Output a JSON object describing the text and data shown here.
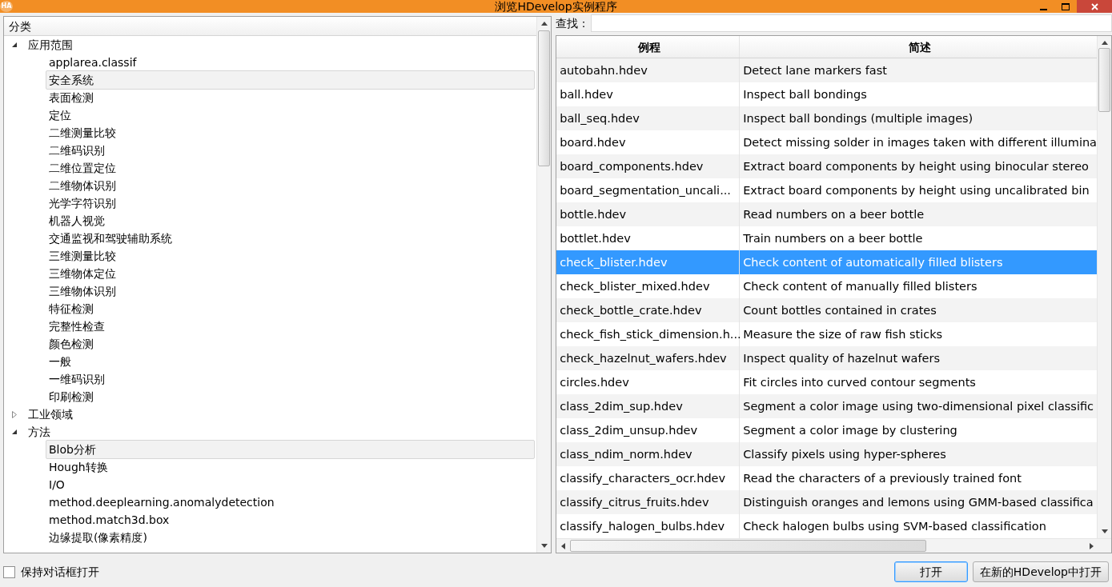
{
  "window": {
    "icon_label": "HA",
    "title": "浏览HDevelop实例程序"
  },
  "tree": {
    "header": "分类",
    "items": [
      {
        "label": "应用范围",
        "expanded": true,
        "selected": false,
        "children": [
          {
            "label": "applarea.classif",
            "selected": false
          },
          {
            "label": "安全系统",
            "selected": true
          },
          {
            "label": "表面检测",
            "selected": false
          },
          {
            "label": "定位",
            "selected": false
          },
          {
            "label": "二维测量比较",
            "selected": false
          },
          {
            "label": "二维码识别",
            "selected": false
          },
          {
            "label": "二维位置定位",
            "selected": false
          },
          {
            "label": "二维物体识别",
            "selected": false
          },
          {
            "label": "光学字符识别",
            "selected": false
          },
          {
            "label": "机器人视觉",
            "selected": false
          },
          {
            "label": "交通监视和驾驶辅助系统",
            "selected": false
          },
          {
            "label": "三维测量比较",
            "selected": false
          },
          {
            "label": "三维物体定位",
            "selected": false
          },
          {
            "label": "三维物体识别",
            "selected": false
          },
          {
            "label": "特征检测",
            "selected": false
          },
          {
            "label": "完整性检查",
            "selected": false
          },
          {
            "label": "颜色检测",
            "selected": false
          },
          {
            "label": "一般",
            "selected": false
          },
          {
            "label": "一维码识别",
            "selected": false
          },
          {
            "label": "印刷检测",
            "selected": false
          }
        ]
      },
      {
        "label": "工业领域",
        "expanded": false,
        "selected": false
      },
      {
        "label": "方法",
        "expanded": true,
        "selected": false,
        "children": [
          {
            "label": "Blob分析",
            "selected": true
          },
          {
            "label": "Hough转换",
            "selected": false
          },
          {
            "label": "I/O",
            "selected": false
          },
          {
            "label": "method.deeplearning.anomalydetection",
            "selected": false
          },
          {
            "label": "method.match3d.box",
            "selected": false
          },
          {
            "label": "边缘提取(像素精度)",
            "selected": false
          }
        ]
      }
    ]
  },
  "search": {
    "label": "查找："
  },
  "table": {
    "columns": [
      "例程",
      "简述"
    ],
    "rows": [
      {
        "cells": [
          "autobahn.hdev",
          "Detect lane markers fast"
        ],
        "selected": false
      },
      {
        "cells": [
          "ball.hdev",
          "Inspect ball bondings"
        ],
        "selected": false
      },
      {
        "cells": [
          "ball_seq.hdev",
          "Inspect ball bondings (multiple images)"
        ],
        "selected": false
      },
      {
        "cells": [
          "board.hdev",
          "Detect missing solder in images taken with different illumina"
        ],
        "selected": false
      },
      {
        "cells": [
          "board_components.hdev",
          "Extract board components by height using binocular stereo"
        ],
        "selected": false
      },
      {
        "cells": [
          "board_segmentation_uncali...",
          "Extract board components by height using uncalibrated bin"
        ],
        "selected": false
      },
      {
        "cells": [
          "bottle.hdev",
          "Read numbers on a beer bottle"
        ],
        "selected": false
      },
      {
        "cells": [
          "bottlet.hdev",
          "Train numbers on a beer bottle"
        ],
        "selected": false
      },
      {
        "cells": [
          "check_blister.hdev",
          "Check content of automatically filled blisters"
        ],
        "selected": true
      },
      {
        "cells": [
          "check_blister_mixed.hdev",
          "Check content of manually filled blisters"
        ],
        "selected": false
      },
      {
        "cells": [
          "check_bottle_crate.hdev",
          "Count bottles contained in crates"
        ],
        "selected": false
      },
      {
        "cells": [
          "check_fish_stick_dimension.h...",
          "Measure the size of raw fish sticks"
        ],
        "selected": false
      },
      {
        "cells": [
          "check_hazelnut_wafers.hdev",
          "Inspect quality of hazelnut wafers"
        ],
        "selected": false
      },
      {
        "cells": [
          "circles.hdev",
          "Fit circles into curved contour segments"
        ],
        "selected": false
      },
      {
        "cells": [
          "class_2dim_sup.hdev",
          "Segment a color image using two-dimensional pixel classific"
        ],
        "selected": false
      },
      {
        "cells": [
          "class_2dim_unsup.hdev",
          "Segment a color image by clustering"
        ],
        "selected": false
      },
      {
        "cells": [
          "class_ndim_norm.hdev",
          "Classify pixels using hyper-spheres"
        ],
        "selected": false
      },
      {
        "cells": [
          "classify_characters_ocr.hdev",
          "Read the characters of a previously trained font"
        ],
        "selected": false
      },
      {
        "cells": [
          "classify_citrus_fruits.hdev",
          "Distinguish oranges and lemons using GMM-based classifica"
        ],
        "selected": false
      },
      {
        "cells": [
          "classify_halogen_bulbs.hdev",
          "Check halogen bulbs using SVM-based classification"
        ],
        "selected": false
      }
    ]
  },
  "keep_open": {
    "label": "保持对话框打开",
    "checked": false
  },
  "buttons": [
    {
      "label": "打开",
      "default": true
    },
    {
      "label": "在新的HDevelop中打开",
      "default": false
    }
  ]
}
